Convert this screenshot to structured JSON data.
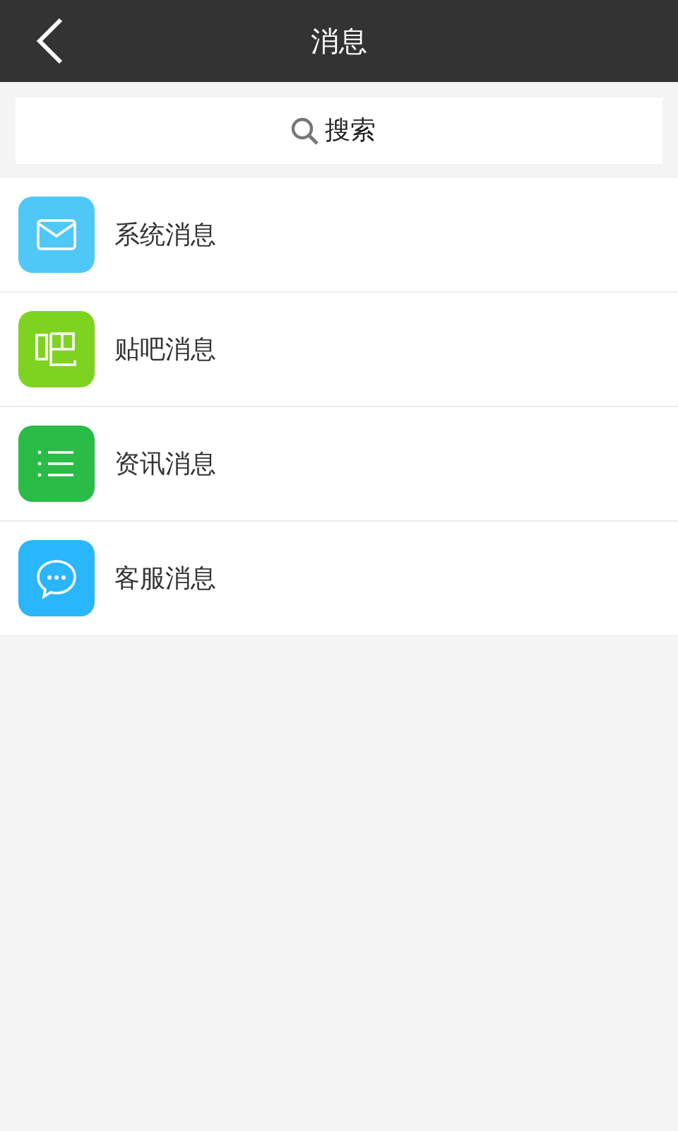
{
  "header": {
    "title": "消息"
  },
  "search": {
    "placeholder": "搜索"
  },
  "items": [
    {
      "label": "系统消息",
      "kind": "mail",
      "color": "#4fc8f7"
    },
    {
      "label": "贴吧消息",
      "kind": "forum",
      "color": "#7ed321"
    },
    {
      "label": "资讯消息",
      "kind": "list",
      "color": "#2bbb47"
    },
    {
      "label": "客服消息",
      "kind": "chat",
      "color": "#29b6fb"
    }
  ]
}
